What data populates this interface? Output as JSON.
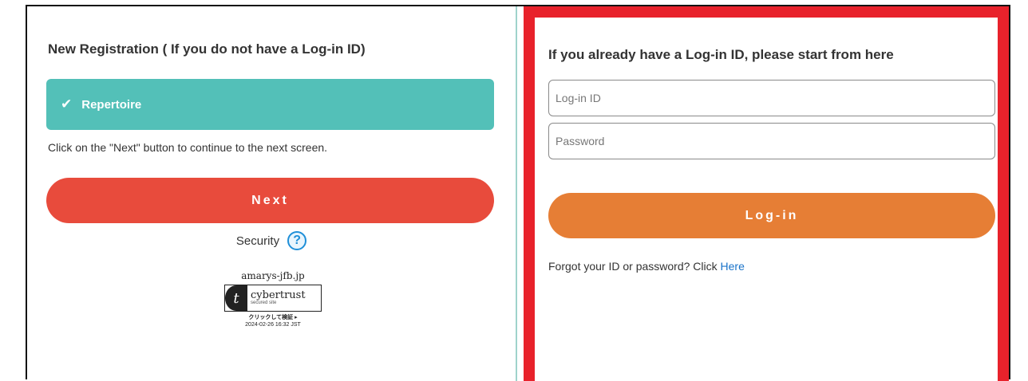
{
  "registration": {
    "heading": "New Registration ( If you do not have a Log-in ID)",
    "option_label": "Repertoire",
    "instruction": "Click on the \"Next\" button to continue to the next screen.",
    "next_label": "Next",
    "security_label": "Security",
    "help_glyph": "?"
  },
  "seal": {
    "domain": "amarys-jfb.jp",
    "brand": "cybertrust",
    "sub": "secured site",
    "verify": "クリックして検証 ▸",
    "date": "2024-02-26 16:32 JST"
  },
  "login": {
    "heading": "If you already have a Log-in ID, please start from here",
    "login_id_placeholder": "Log-in ID",
    "password_placeholder": "Password",
    "login_label": "Log-in",
    "forgot_text": "Forgot your ID or password? Click ",
    "forgot_link": "Here"
  },
  "colors": {
    "option_bg": "#53c0b8",
    "next_bg": "#e84b3c",
    "login_bg": "#e67e35",
    "highlight_border": "#e8222b",
    "link": "#1a73c9"
  },
  "icons": {
    "check": "check-icon",
    "help": "question-circle-icon",
    "seal_logo": "cybertrust-logo-icon"
  }
}
